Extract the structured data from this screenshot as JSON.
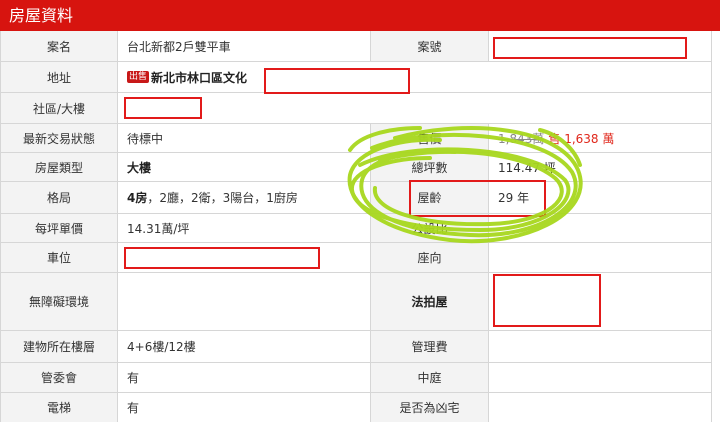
{
  "section_title": "房屋資料",
  "rows": {
    "case_name": {
      "label": "案名",
      "value": "台北新都2戶雙平車"
    },
    "case_no": {
      "label": "案號"
    },
    "address": {
      "label": "地址",
      "tag": "出售",
      "value": "新北市林口區文化"
    },
    "community": {
      "label": "社區/大樓"
    },
    "status": {
      "label": "最新交易狀態",
      "value": "待標中"
    },
    "price": {
      "label": "售價",
      "old": "1,843萬",
      "new_prefix": "售",
      "new": "1,638 萬"
    },
    "house_type": {
      "label": "房屋類型",
      "value": "大樓"
    },
    "area": {
      "label": "總坪數",
      "value": "114.47 坪"
    },
    "layout": {
      "label": "格局",
      "value_bold": "4房",
      "value": "，2廳，2衛，3陽台，1廚房"
    },
    "age": {
      "label": "屋齡",
      "value": "29 年"
    },
    "unit_price": {
      "label": "每坪單價",
      "value": "14.31萬/坪"
    },
    "public_ratio": {
      "label": "公設比"
    },
    "parking": {
      "label": "車位"
    },
    "orientation": {
      "label": "座向"
    },
    "accessible": {
      "label": "無障礙環境"
    },
    "auction": {
      "label": "法拍屋"
    },
    "floor": {
      "label": "建物所在樓層",
      "value": "4+6樓/12樓"
    },
    "mgmt_fee": {
      "label": "管理費"
    },
    "committee": {
      "label": "管委會",
      "value": "有"
    },
    "courtyard": {
      "label": "中庭"
    },
    "elevator": {
      "label": "電梯",
      "value": "有"
    },
    "haunted": {
      "label": "是否為凶宅"
    }
  },
  "colors": {
    "header": "#d7140f",
    "label_bg": "#f3f3f3",
    "annotation_box": "#e21a1a",
    "scribble": "#a8d81e",
    "price_red": "#e0271b"
  }
}
